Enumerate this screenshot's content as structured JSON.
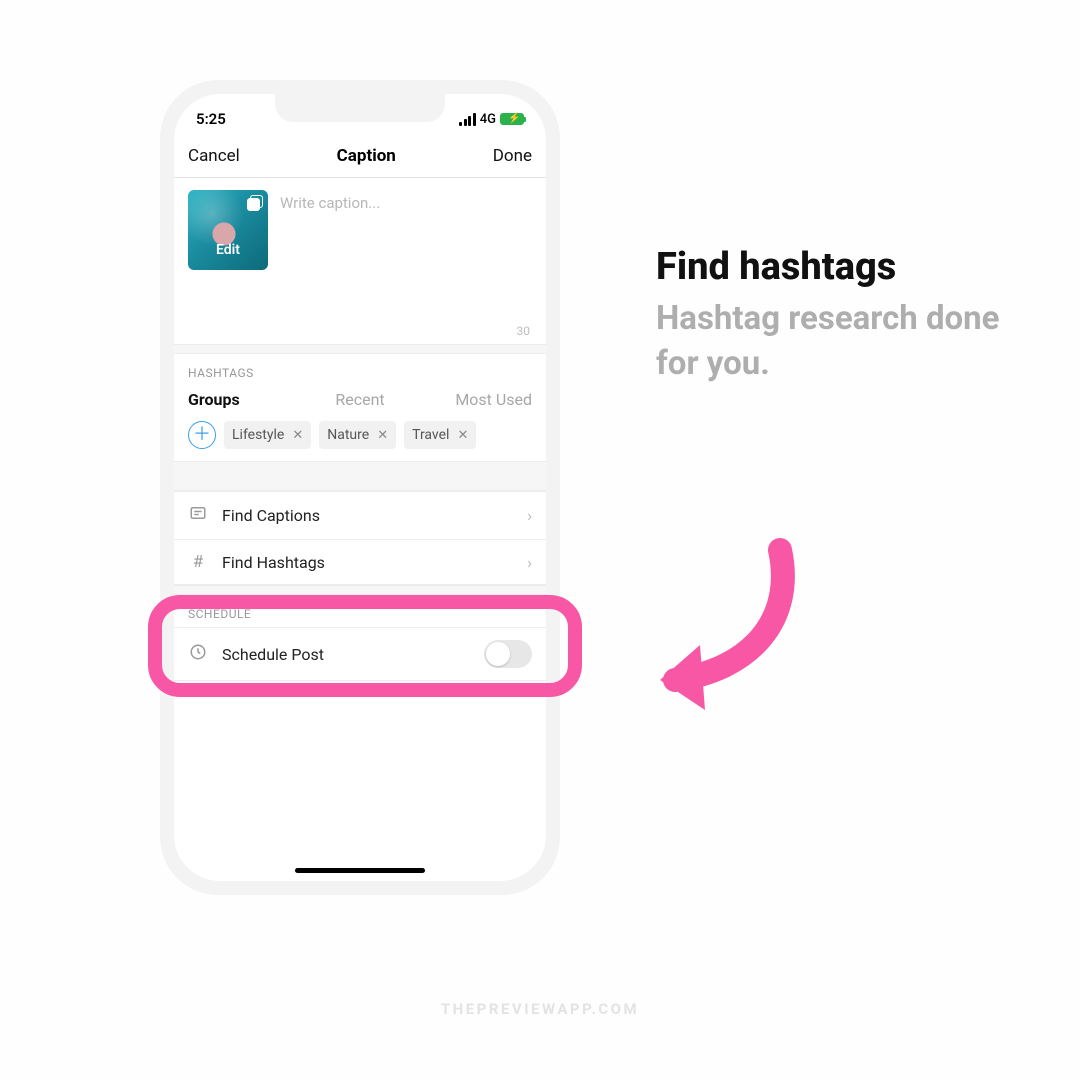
{
  "status": {
    "time": "5:25",
    "network": "4G"
  },
  "nav": {
    "cancel": "Cancel",
    "title": "Caption",
    "done": "Done"
  },
  "caption": {
    "placeholder": "Write caption...",
    "thumb_label": "Edit",
    "counter": "30"
  },
  "hashtags": {
    "header": "HASHTAGS",
    "tabs": {
      "groups": "Groups",
      "recent": "Recent",
      "most_used": "Most Used"
    },
    "chips": [
      "Lifestyle",
      "Nature",
      "Travel"
    ]
  },
  "rows": {
    "find_captions": "Find Captions",
    "find_hashtags": "Find Hashtags"
  },
  "schedule": {
    "header": "SCHEDULE",
    "label": "Schedule Post"
  },
  "side": {
    "title": "Find hashtags",
    "subtitle": "Hashtag research done for you."
  },
  "footer": "THEPREVIEWAPP.COM",
  "colors": {
    "accent": "#f857a6",
    "plus": "#3aa1ea"
  }
}
